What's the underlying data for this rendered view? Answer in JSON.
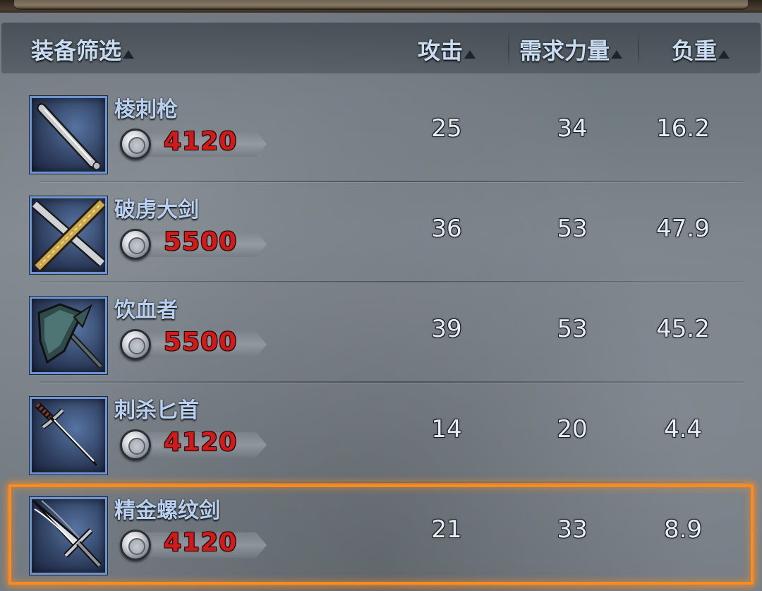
{
  "header": {
    "filter_label": "装备筛选",
    "col_attack": "攻击",
    "col_strength": "需求力量",
    "col_weight": "负重"
  },
  "items": [
    {
      "name": "棱刺枪",
      "price": "4120",
      "attack": "25",
      "strength": "34",
      "weight": "16.2",
      "icon": "spear-icon"
    },
    {
      "name": "破虏大剑",
      "price": "5500",
      "attack": "36",
      "strength": "53",
      "weight": "47.9",
      "icon": "greatsword-icon"
    },
    {
      "name": "饮血者",
      "price": "5500",
      "attack": "39",
      "strength": "53",
      "weight": "45.2",
      "icon": "halberd-icon"
    },
    {
      "name": "刺杀匕首",
      "price": "4120",
      "attack": "14",
      "strength": "20",
      "weight": "4.4",
      "icon": "dagger-icon"
    },
    {
      "name": "精金螺纹剑",
      "price": "4120",
      "attack": "21",
      "strength": "33",
      "weight": "8.9",
      "icon": "sword-icon"
    }
  ],
  "selected_index": 4,
  "colors": {
    "price": "#d11b1b",
    "selection": "#ff8a1e",
    "icon_border": "#6f93cf",
    "name_text": "#b9d0f0"
  }
}
